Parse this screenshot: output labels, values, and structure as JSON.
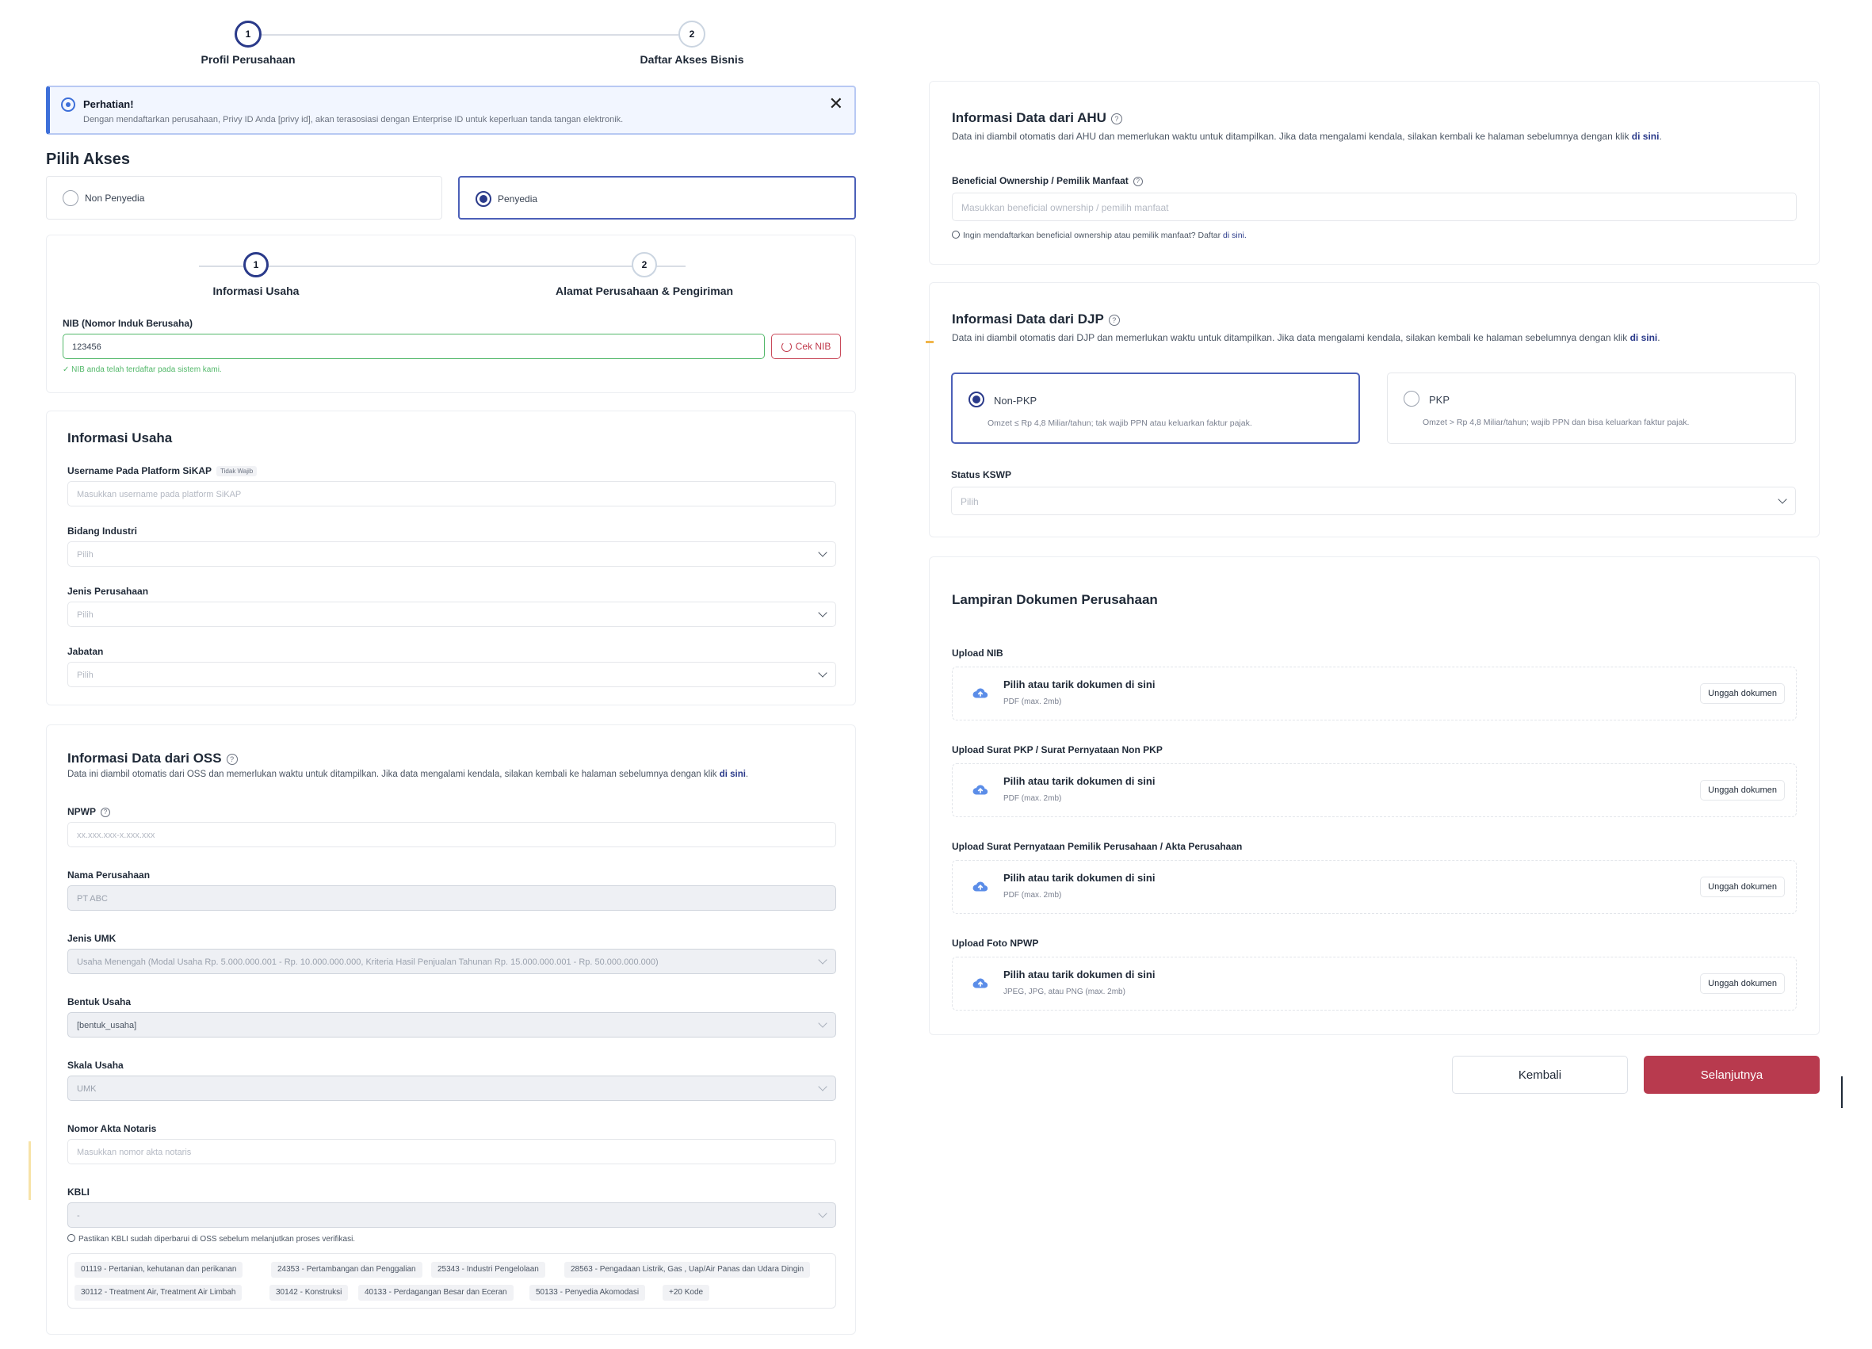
{
  "stepper": {
    "steps": [
      {
        "number": "1",
        "label": "Profil Perusahaan"
      },
      {
        "number": "2",
        "label": "Daftar Akses Bisnis"
      }
    ]
  },
  "alert": {
    "title": "Perhatian!",
    "text": "Dengan mendaftarkan perusahaan, Privy ID Anda [privy id], akan terasosiasi dengan Enterprise ID untuk keperluan tanda tangan elektronik."
  },
  "access": {
    "title": "Pilih Akses",
    "options": [
      {
        "label": "Non Penyedia",
        "selected": false
      },
      {
        "label": "Penyedia",
        "selected": true
      }
    ]
  },
  "sub_stepper": {
    "steps": [
      {
        "number": "1",
        "label": "Informasi Usaha"
      },
      {
        "number": "2",
        "label": "Alamat Perusahaan & Pengiriman"
      }
    ]
  },
  "nib": {
    "label": "NIB (Nomor Induk Berusaha)",
    "value": "123456",
    "button": "Cek NIB",
    "success": "✓ NIB anda telah terdaftar pada sistem kami."
  },
  "informasi_usaha": {
    "title": "Informasi Usaha",
    "username_label": "Username Pada Platform SiKAP",
    "username_badge": "Tidak Wajib",
    "username_placeholder": "Masukkan username pada platform SiKAP",
    "bidang_label": "Bidang Industri",
    "bidang_value": "Pilih",
    "jenis_label": "Jenis Perusahaan",
    "jenis_value": "Pilih",
    "jabatan_label": "Jabatan",
    "jabatan_value": "Pilih"
  },
  "oss": {
    "title": "Informasi Data dari OSS",
    "desc": "Data ini diambil otomatis dari OSS dan memerlukan waktu untuk ditampilkan. Jika data mengalami kendala, silakan kembali ke halaman sebelumnya dengan klik",
    "link": "di sini",
    "npwp_label": "NPWP",
    "npwp_placeholder": "xx.xxx.xxx-x.xxx.xxx",
    "nama_label": "Nama Perusahaan",
    "nama_value": "PT ABC",
    "umk_label": "Jenis UMK",
    "umk_value": "Usaha Menengah (Modal Usaha Rp. 5.000.000.001 - Rp. 10.000.000.000, Kriteria Hasil Penjualan Tahunan Rp. 15.000.000.001 - Rp. 50.000.000.000)",
    "bentuk_label": "Bentuk Usaha",
    "bentuk_value": "[bentuk_usaha]",
    "skala_label": "Skala Usaha",
    "skala_value": "UMK",
    "akta_label": "Nomor Akta Notaris",
    "akta_placeholder": "Masukkan nomor akta notaris",
    "kbli_label": "KBLI",
    "kbli_value": "-",
    "kbli_hint": "Pastikan KBLI sudah diperbarui di OSS sebelum melanjutkan proses verifikasi.",
    "kbli_chips": [
      "01119 - Pertanian, kehutanan dan perikanan",
      "24353 - Pertambangan dan Penggalian",
      "25343 - Industri Pengelolaan",
      "28563 - Pengadaan Listrik, Gas , Uap/Air Panas dan Udara Dingin",
      "30112 - Treatment Air, Treatment Air Limbah",
      "30142 - Konstruksi",
      "40133 - Perdagangan Besar dan Eceran",
      "50133 - Penyedia Akomodasi",
      "+20 Kode"
    ]
  },
  "ahu": {
    "title": "Informasi Data dari AHU",
    "desc": "Data ini diambil otomatis dari AHU dan memerlukan waktu untuk ditampilkan. Jika data mengalami kendala, silakan kembali ke halaman sebelumnya dengan klik",
    "link": "di sini",
    "bo_label": "Beneficial Ownership / Pemilik Manfaat",
    "bo_placeholder": "Masukkan beneficial ownership / pemilih manfaat",
    "bo_hint": "Ingin mendaftarkan beneficial ownership atau pemilik manfaat? Daftar",
    "bo_hint_link": "di sini."
  },
  "djp": {
    "title": "Informasi Data dari DJP",
    "desc": "Data ini diambil otomatis dari DJP dan memerlukan waktu untuk ditampilkan. Jika data mengalami kendala, silakan kembali ke halaman sebelumnya dengan klik",
    "link": "di sini",
    "options": [
      {
        "name": "Non-PKP",
        "sub": "Omzet ≤ Rp 4,8 Miliar/tahun; tak wajib PPN atau keluarkan faktur pajak.",
        "selected": true
      },
      {
        "name": "PKP",
        "sub": "Omzet > Rp 4,8 Miliar/tahun; wajib PPN dan bisa keluarkan faktur pajak.",
        "selected": false
      }
    ],
    "kswp_label": "Status KSWP",
    "kswp_value": "Pilih"
  },
  "lampiran": {
    "title": "Lampiran Dokumen Perusahaan",
    "uploads": [
      {
        "label": "Upload NIB",
        "title": "Pilih atau tarik dokumen di sini",
        "sub": "PDF (max. 2mb)",
        "button": "Unggah dokumen"
      },
      {
        "label": "Upload Surat PKP / Surat Pernyataan Non PKP",
        "title": "Pilih atau tarik dokumen di sini",
        "sub": "PDF (max. 2mb)",
        "button": "Unggah dokumen"
      },
      {
        "label": "Upload Surat Pernyataan Pemilik Perusahaan / Akta Perusahaan",
        "title": "Pilih atau tarik dokumen di sini",
        "sub": "PDF (max. 2mb)",
        "button": "Unggah dokumen"
      },
      {
        "label": "Upload Foto NPWP",
        "title": "Pilih atau tarik dokumen di sini",
        "sub": "JPEG, JPG, atau PNG (max. 2mb)",
        "button": "Unggah dokumen"
      }
    ]
  },
  "actions": {
    "back": "Kembali",
    "next": "Selanjutnya"
  },
  "colors": {
    "primary_navy": "#2a3a8a",
    "accent_red": "#b83a4e",
    "success_green": "#53b86a",
    "info_blue": "#3d6fd9"
  }
}
